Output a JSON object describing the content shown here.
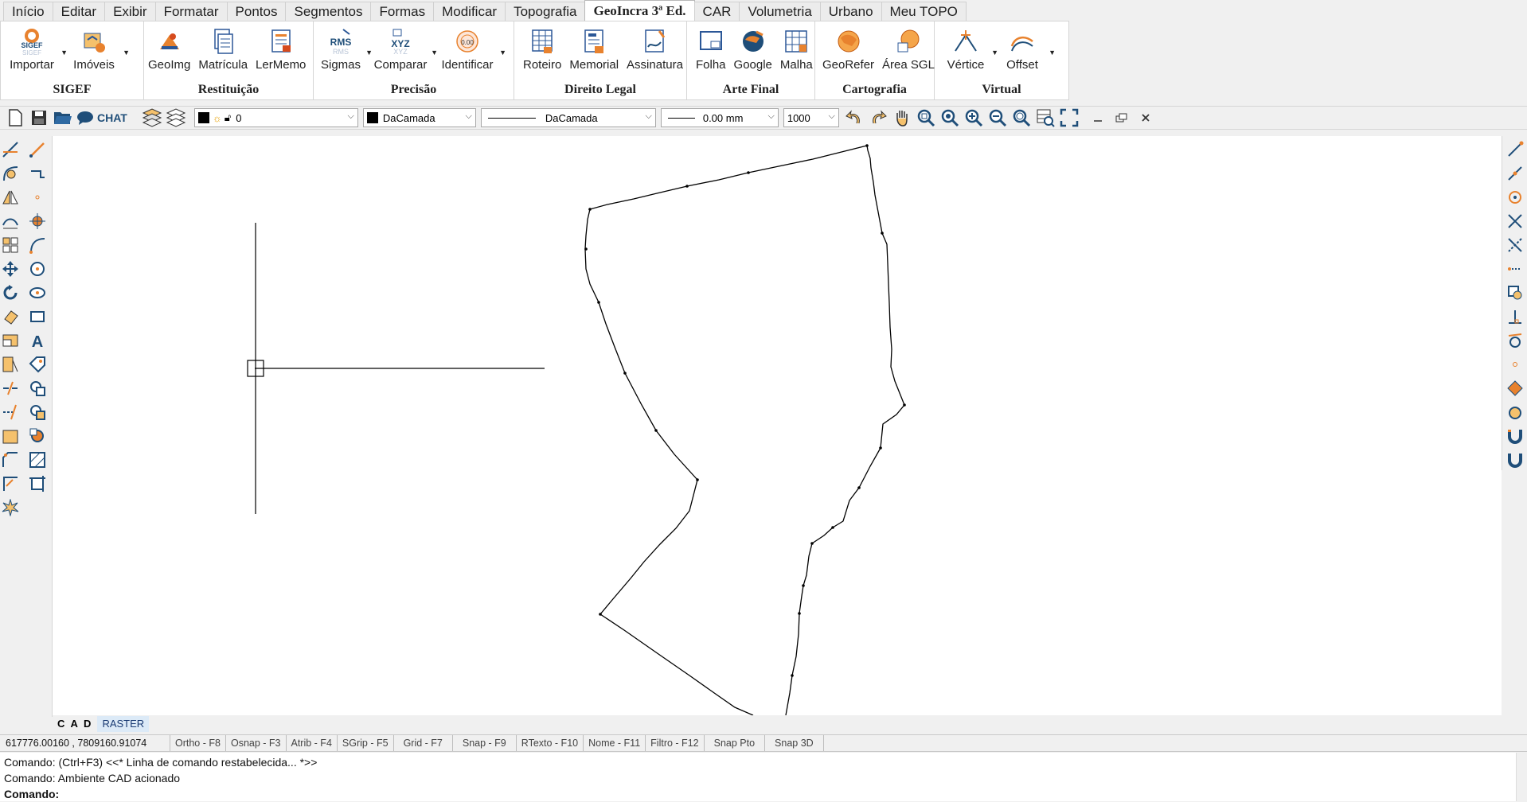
{
  "menu": {
    "tabs": [
      {
        "label": "Início",
        "active": false
      },
      {
        "label": "Editar",
        "active": false
      },
      {
        "label": "Exibir",
        "active": false
      },
      {
        "label": "Formatar",
        "active": false
      },
      {
        "label": "Pontos",
        "active": false
      },
      {
        "label": "Segmentos",
        "active": false
      },
      {
        "label": "Formas",
        "active": false
      },
      {
        "label": "Modificar",
        "active": false
      },
      {
        "label": "Topografia",
        "active": false
      },
      {
        "label": "GeoIncra 3ª Ed.",
        "active": true
      },
      {
        "label": "CAR",
        "active": false
      },
      {
        "label": "Volumetria",
        "active": false
      },
      {
        "label": "Urbano",
        "active": false
      },
      {
        "label": "Meu TOPO",
        "active": false
      }
    ]
  },
  "ribbon": {
    "groups": [
      {
        "label": "SIGEF",
        "buttons": [
          {
            "label": "Importar",
            "icon": "sigef-import-icon",
            "dropdown": true
          },
          {
            "label": "Imóveis",
            "icon": "properties-icon",
            "dropdown": true
          }
        ]
      },
      {
        "label": "Restituição",
        "buttons": [
          {
            "label": "GeoImg",
            "icon": "geoimg-icon",
            "dropdown": false
          },
          {
            "label": "Matrícula",
            "icon": "registry-icon",
            "dropdown": false
          },
          {
            "label": "LerMemo",
            "icon": "read-memo-icon",
            "dropdown": false
          }
        ]
      },
      {
        "label": "Precisão",
        "buttons": [
          {
            "label": "Sigmas",
            "icon": "rms-sigmas-icon",
            "dropdown": true
          },
          {
            "label": "Comparar",
            "icon": "xyz-compare-icon",
            "dropdown": true
          },
          {
            "label": "Identificar",
            "icon": "identify-icon",
            "dropdown": true
          }
        ]
      },
      {
        "label": "Direito Legal",
        "buttons": [
          {
            "label": "Roteiro",
            "icon": "route-table-icon",
            "dropdown": false
          },
          {
            "label": "Memorial",
            "icon": "memorial-icon",
            "dropdown": false
          },
          {
            "label": "Assinatura",
            "icon": "signature-icon",
            "dropdown": false
          }
        ]
      },
      {
        "label": "Arte Final",
        "buttons": [
          {
            "label": "Folha",
            "icon": "sheet-icon",
            "dropdown": false
          },
          {
            "label": "Google",
            "icon": "google-globe-icon",
            "dropdown": false
          },
          {
            "label": "Malha",
            "icon": "grid-mesh-icon",
            "dropdown": false
          }
        ]
      },
      {
        "label": "Cartografia",
        "buttons": [
          {
            "label": "GeoRefer",
            "icon": "georeference-icon",
            "dropdown": false
          },
          {
            "label": "Área SGL",
            "icon": "area-sgl-icon",
            "dropdown": false
          }
        ]
      },
      {
        "label": "Virtual",
        "buttons": [
          {
            "label": "Vértice",
            "icon": "vertex-icon",
            "dropdown": true
          },
          {
            "label": "Offset",
            "icon": "offset-icon",
            "dropdown": true
          }
        ]
      }
    ]
  },
  "toolbar": {
    "chat_label": "CHAT",
    "layer_value": "0",
    "color_value": "DaCamada",
    "linetype_value": "DaCamada",
    "lineweight_value": "0.00 mm",
    "scale_value": "1000"
  },
  "canvas_tabs": {
    "cad": "C A D",
    "raster": "RASTER"
  },
  "status": {
    "coordinates": "617776.00160 , 7809160.91074",
    "items": [
      "Ortho - F8",
      "Osnap - F3",
      "Atrib - F4",
      "SGrip - F5",
      "Grid - F7",
      "Snap - F9",
      "RTexto - F10",
      "Nome - F11",
      "Filtro - F12",
      "Snap Pto",
      "Snap 3D"
    ]
  },
  "command": {
    "lines": [
      "Comando: (Ctrl+F3) <<* Linha de comando restabelecida... *>>",
      "Comando: Ambiente CAD acionado"
    ],
    "prompt": "Comando:"
  },
  "colors": {
    "accent": "#1f4e79",
    "icon_orange": "#e8822e",
    "icon_blue": "#2b5797"
  }
}
